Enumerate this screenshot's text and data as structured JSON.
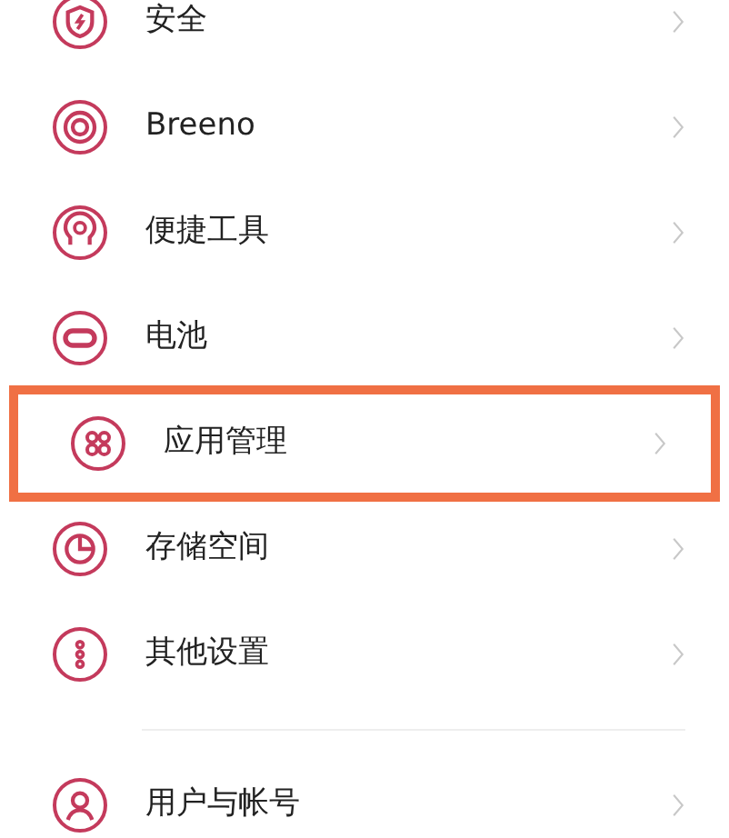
{
  "sections": [
    {
      "items": [
        {
          "label": "安全",
          "highlighted": false
        },
        {
          "label": "Breeno",
          "highlighted": false
        },
        {
          "label": "便捷工具",
          "highlighted": false
        },
        {
          "label": "电池",
          "highlighted": false
        },
        {
          "label": "应用管理",
          "highlighted": true
        },
        {
          "label": "存储空间",
          "highlighted": false
        },
        {
          "label": "其他设置",
          "highlighted": false
        }
      ]
    },
    {
      "items": [
        {
          "label": "用户与帐号",
          "highlighted": false
        }
      ]
    }
  ]
}
